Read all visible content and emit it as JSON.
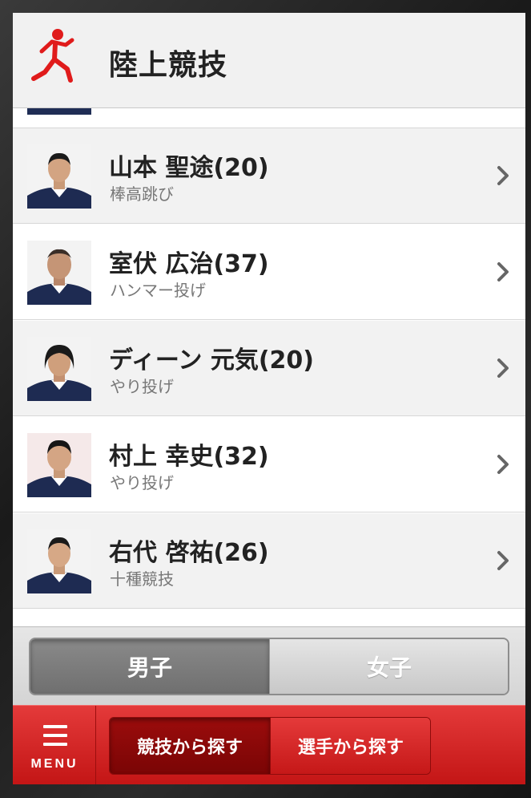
{
  "header": {
    "title": "陸上競技",
    "logo_icon": "runner-icon",
    "accent": "#e01b1b"
  },
  "athletes": [
    {
      "name": "山本 聖途(20)",
      "event": "棒高跳び"
    },
    {
      "name": "室伏 広治(37)",
      "event": "ハンマー投げ"
    },
    {
      "name": "ディーン 元気(20)",
      "event": "やり投げ"
    },
    {
      "name": "村上 幸史(32)",
      "event": "やり投げ"
    },
    {
      "name": "右代 啓祐(26)",
      "event": "十種競技"
    }
  ],
  "gender_toggle": {
    "male": "男子",
    "female": "女子",
    "selected": "male"
  },
  "bottom_bar": {
    "menu_label": "MENU",
    "search_by_event": "競技から探す",
    "search_by_player": "選手から探す",
    "selected": "search_by_event"
  }
}
